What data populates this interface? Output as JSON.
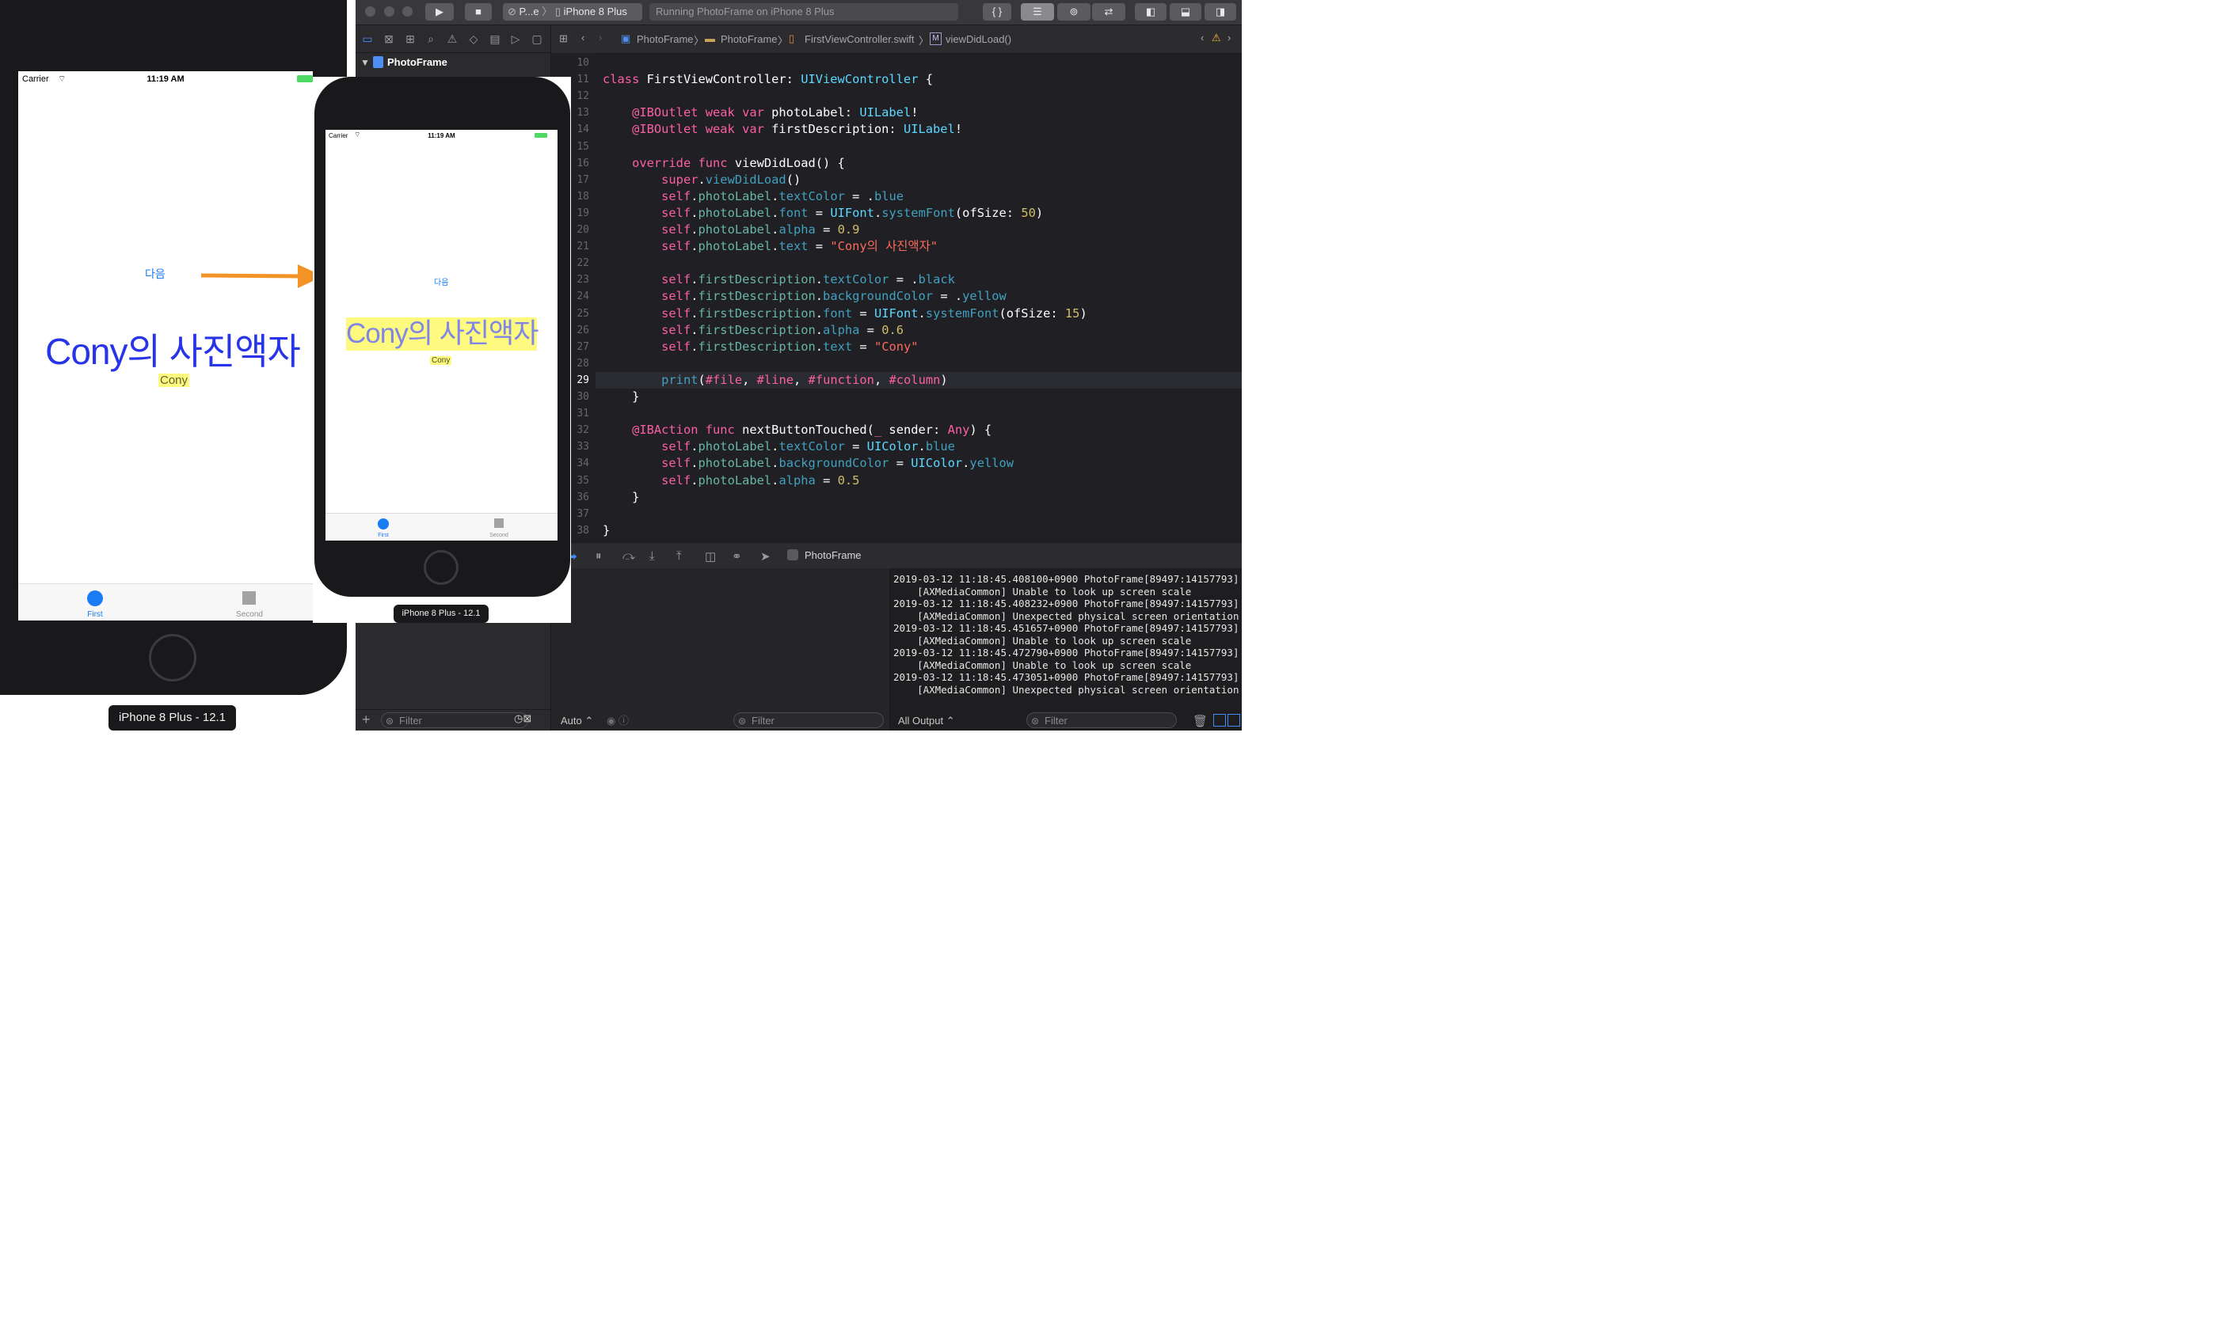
{
  "toolbar": {
    "scheme_short": "P...e",
    "device": "iPhone 8 Plus",
    "status": "Running PhotoFrame on iPhone 8 Plus",
    "braces": "{ }"
  },
  "navigator": {
    "project": "PhotoFrame",
    "filter_placeholder": "Filter"
  },
  "jumpbar": {
    "crumbs": [
      "PhotoFrame",
      "PhotoFrame",
      "FirstViewController.swift",
      "viewDidLoad()"
    ]
  },
  "code_lines": [
    {
      "n": "10",
      "segs": []
    },
    {
      "n": "11",
      "segs": [
        {
          "c": "k",
          "t": "class"
        },
        {
          "c": "w",
          "t": " FirstViewController: "
        },
        {
          "c": "t",
          "t": "UIViewController"
        },
        {
          "c": "w",
          "t": " {"
        }
      ]
    },
    {
      "n": "12",
      "segs": []
    },
    {
      "n": "13",
      "outlet": true,
      "segs": [
        {
          "c": "w",
          "t": "    "
        },
        {
          "c": "k",
          "t": "@IBOutlet weak var"
        },
        {
          "c": "w",
          "t": " photoLabel: "
        },
        {
          "c": "t",
          "t": "UILabel"
        },
        {
          "c": "w",
          "t": "!"
        }
      ]
    },
    {
      "n": "14",
      "outlet": true,
      "segs": [
        {
          "c": "w",
          "t": "    "
        },
        {
          "c": "k",
          "t": "@IBOutlet weak var"
        },
        {
          "c": "w",
          "t": " firstDescription: "
        },
        {
          "c": "t",
          "t": "UILabel"
        },
        {
          "c": "w",
          "t": "!"
        }
      ]
    },
    {
      "n": "15",
      "segs": []
    },
    {
      "n": "16",
      "segs": [
        {
          "c": "w",
          "t": "    "
        },
        {
          "c": "k",
          "t": "override func"
        },
        {
          "c": "w",
          "t": " viewDidLoad() {"
        }
      ]
    },
    {
      "n": "17",
      "segs": [
        {
          "c": "w",
          "t": "        "
        },
        {
          "c": "k",
          "t": "super"
        },
        {
          "c": "w",
          "t": "."
        },
        {
          "c": "a",
          "t": "viewDidLoad"
        },
        {
          "c": "w",
          "t": "()"
        }
      ]
    },
    {
      "n": "18",
      "segs": [
        {
          "c": "w",
          "t": "        "
        },
        {
          "c": "k",
          "t": "self"
        },
        {
          "c": "w",
          "t": "."
        },
        {
          "c": "m",
          "t": "photoLabel"
        },
        {
          "c": "w",
          "t": "."
        },
        {
          "c": "a",
          "t": "textColor"
        },
        {
          "c": "w",
          "t": " = ."
        },
        {
          "c": "a",
          "t": "blue"
        }
      ]
    },
    {
      "n": "19",
      "segs": [
        {
          "c": "w",
          "t": "        "
        },
        {
          "c": "k",
          "t": "self"
        },
        {
          "c": "w",
          "t": "."
        },
        {
          "c": "m",
          "t": "photoLabel"
        },
        {
          "c": "w",
          "t": "."
        },
        {
          "c": "a",
          "t": "font"
        },
        {
          "c": "w",
          "t": " = "
        },
        {
          "c": "t",
          "t": "UIFont"
        },
        {
          "c": "w",
          "t": "."
        },
        {
          "c": "a",
          "t": "systemFont"
        },
        {
          "c": "w",
          "t": "(ofSize: "
        },
        {
          "c": "n",
          "t": "50"
        },
        {
          "c": "w",
          "t": ")"
        }
      ]
    },
    {
      "n": "20",
      "segs": [
        {
          "c": "w",
          "t": "        "
        },
        {
          "c": "k",
          "t": "self"
        },
        {
          "c": "w",
          "t": "."
        },
        {
          "c": "m",
          "t": "photoLabel"
        },
        {
          "c": "w",
          "t": "."
        },
        {
          "c": "a",
          "t": "alpha"
        },
        {
          "c": "w",
          "t": " = "
        },
        {
          "c": "n",
          "t": "0.9"
        }
      ]
    },
    {
      "n": "21",
      "segs": [
        {
          "c": "w",
          "t": "        "
        },
        {
          "c": "k",
          "t": "self"
        },
        {
          "c": "w",
          "t": "."
        },
        {
          "c": "m",
          "t": "photoLabel"
        },
        {
          "c": "w",
          "t": "."
        },
        {
          "c": "a",
          "t": "text"
        },
        {
          "c": "w",
          "t": " = "
        },
        {
          "c": "s",
          "t": "\"Cony의 사진액자\""
        }
      ]
    },
    {
      "n": "22",
      "segs": []
    },
    {
      "n": "23",
      "segs": [
        {
          "c": "w",
          "t": "        "
        },
        {
          "c": "k",
          "t": "self"
        },
        {
          "c": "w",
          "t": "."
        },
        {
          "c": "m",
          "t": "firstDescription"
        },
        {
          "c": "w",
          "t": "."
        },
        {
          "c": "a",
          "t": "textColor"
        },
        {
          "c": "w",
          "t": " = ."
        },
        {
          "c": "a",
          "t": "black"
        }
      ]
    },
    {
      "n": "24",
      "segs": [
        {
          "c": "w",
          "t": "        "
        },
        {
          "c": "k",
          "t": "self"
        },
        {
          "c": "w",
          "t": "."
        },
        {
          "c": "m",
          "t": "firstDescription"
        },
        {
          "c": "w",
          "t": "."
        },
        {
          "c": "a",
          "t": "backgroundColor"
        },
        {
          "c": "w",
          "t": " = ."
        },
        {
          "c": "a",
          "t": "yellow"
        }
      ]
    },
    {
      "n": "25",
      "segs": [
        {
          "c": "w",
          "t": "        "
        },
        {
          "c": "k",
          "t": "self"
        },
        {
          "c": "w",
          "t": "."
        },
        {
          "c": "m",
          "t": "firstDescription"
        },
        {
          "c": "w",
          "t": "."
        },
        {
          "c": "a",
          "t": "font"
        },
        {
          "c": "w",
          "t": " = "
        },
        {
          "c": "t",
          "t": "UIFont"
        },
        {
          "c": "w",
          "t": "."
        },
        {
          "c": "a",
          "t": "systemFont"
        },
        {
          "c": "w",
          "t": "(ofSize: "
        },
        {
          "c": "n",
          "t": "15"
        },
        {
          "c": "w",
          "t": ")"
        }
      ]
    },
    {
      "n": "26",
      "segs": [
        {
          "c": "w",
          "t": "        "
        },
        {
          "c": "k",
          "t": "self"
        },
        {
          "c": "w",
          "t": "."
        },
        {
          "c": "m",
          "t": "firstDescription"
        },
        {
          "c": "w",
          "t": "."
        },
        {
          "c": "a",
          "t": "alpha"
        },
        {
          "c": "w",
          "t": " = "
        },
        {
          "c": "n",
          "t": "0.6"
        }
      ]
    },
    {
      "n": "27",
      "segs": [
        {
          "c": "w",
          "t": "        "
        },
        {
          "c": "k",
          "t": "self"
        },
        {
          "c": "w",
          "t": "."
        },
        {
          "c": "m",
          "t": "firstDescription"
        },
        {
          "c": "w",
          "t": "."
        },
        {
          "c": "a",
          "t": "text"
        },
        {
          "c": "w",
          "t": " = "
        },
        {
          "c": "s",
          "t": "\"Cony\""
        }
      ]
    },
    {
      "n": "28",
      "segs": []
    },
    {
      "n": "29",
      "current": true,
      "segs": [
        {
          "c": "w",
          "t": "        "
        },
        {
          "c": "a",
          "t": "print"
        },
        {
          "c": "w",
          "t": "("
        },
        {
          "c": "k",
          "t": "#file"
        },
        {
          "c": "w",
          "t": ", "
        },
        {
          "c": "k",
          "t": "#line"
        },
        {
          "c": "w",
          "t": ", "
        },
        {
          "c": "k",
          "t": "#function"
        },
        {
          "c": "w",
          "t": ", "
        },
        {
          "c": "k",
          "t": "#column"
        },
        {
          "c": "w",
          "t": ")"
        }
      ]
    },
    {
      "n": "30",
      "segs": [
        {
          "c": "w",
          "t": "    }"
        }
      ]
    },
    {
      "n": "31",
      "segs": []
    },
    {
      "n": "32",
      "outlet": true,
      "segs": [
        {
          "c": "w",
          "t": "    "
        },
        {
          "c": "k",
          "t": "@IBAction func"
        },
        {
          "c": "w",
          "t": " nextButtonTouched("
        },
        {
          "c": "k",
          "t": "_"
        },
        {
          "c": "w",
          "t": " sender: "
        },
        {
          "c": "k",
          "t": "Any"
        },
        {
          "c": "w",
          "t": ") {"
        }
      ]
    },
    {
      "n": "33",
      "segs": [
        {
          "c": "w",
          "t": "        "
        },
        {
          "c": "k",
          "t": "self"
        },
        {
          "c": "w",
          "t": "."
        },
        {
          "c": "m",
          "t": "photoLabel"
        },
        {
          "c": "w",
          "t": "."
        },
        {
          "c": "a",
          "t": "textColor"
        },
        {
          "c": "w",
          "t": " = "
        },
        {
          "c": "t",
          "t": "UIColor"
        },
        {
          "c": "w",
          "t": "."
        },
        {
          "c": "a",
          "t": "blue"
        }
      ]
    },
    {
      "n": "34",
      "segs": [
        {
          "c": "w",
          "t": "        "
        },
        {
          "c": "k",
          "t": "self"
        },
        {
          "c": "w",
          "t": "."
        },
        {
          "c": "m",
          "t": "photoLabel"
        },
        {
          "c": "w",
          "t": "."
        },
        {
          "c": "a",
          "t": "backgroundColor"
        },
        {
          "c": "w",
          "t": " = "
        },
        {
          "c": "t",
          "t": "UIColor"
        },
        {
          "c": "w",
          "t": "."
        },
        {
          "c": "a",
          "t": "yellow"
        }
      ]
    },
    {
      "n": "35",
      "segs": [
        {
          "c": "w",
          "t": "        "
        },
        {
          "c": "k",
          "t": "self"
        },
        {
          "c": "w",
          "t": "."
        },
        {
          "c": "m",
          "t": "photoLabel"
        },
        {
          "c": "w",
          "t": "."
        },
        {
          "c": "a",
          "t": "alpha"
        },
        {
          "c": "w",
          "t": " = "
        },
        {
          "c": "n",
          "t": "0.5"
        }
      ]
    },
    {
      "n": "36",
      "segs": [
        {
          "c": "w",
          "t": "    }"
        }
      ]
    },
    {
      "n": "37",
      "segs": []
    },
    {
      "n": "38",
      "segs": [
        {
          "c": "w",
          "t": "}"
        }
      ]
    }
  ],
  "debug": {
    "target": "PhotoFrame",
    "var_mode": "Auto",
    "var_filter": "Filter",
    "output_mode": "All Output",
    "console_filter": "Filter",
    "console_lines": [
      "2019-03-12 11:18:45.408100+0900 PhotoFrame[89497:14157793]",
      "    [AXMediaCommon] Unable to look up screen scale",
      "2019-03-12 11:18:45.408232+0900 PhotoFrame[89497:14157793]",
      "    [AXMediaCommon] Unexpected physical screen orientation",
      "2019-03-12 11:18:45.451657+0900 PhotoFrame[89497:14157793]",
      "    [AXMediaCommon] Unable to look up screen scale",
      "2019-03-12 11:18:45.472790+0900 PhotoFrame[89497:14157793]",
      "    [AXMediaCommon] Unable to look up screen scale",
      "2019-03-12 11:18:45.473051+0900 PhotoFrame[89497:14157793]",
      "    [AXMediaCommon] Unexpected physical screen orientation"
    ]
  },
  "sim1": {
    "carrier": "Carrier",
    "time": "11:19 AM",
    "next_button": "다음",
    "photo_label": "Cony의 사진액자",
    "description": "Cony",
    "tab_first": "First",
    "tab_second": "Second",
    "device_label": "iPhone 8 Plus - 12.1"
  },
  "sim2": {
    "carrier": "Carrier",
    "time": "11:19 AM",
    "next_button": "다음",
    "photo_label": "Cony의 사진액자",
    "description": "Cony",
    "tab_first": "First",
    "tab_second": "Second",
    "device_label": "iPhone 8 Plus - 12.1"
  },
  "colors": {
    "accent_blue": "#1a7cf5",
    "photo_label_blue": "#2734e8",
    "highlight_yellow": "#fefa7f",
    "arrow_orange": "#f39325"
  }
}
